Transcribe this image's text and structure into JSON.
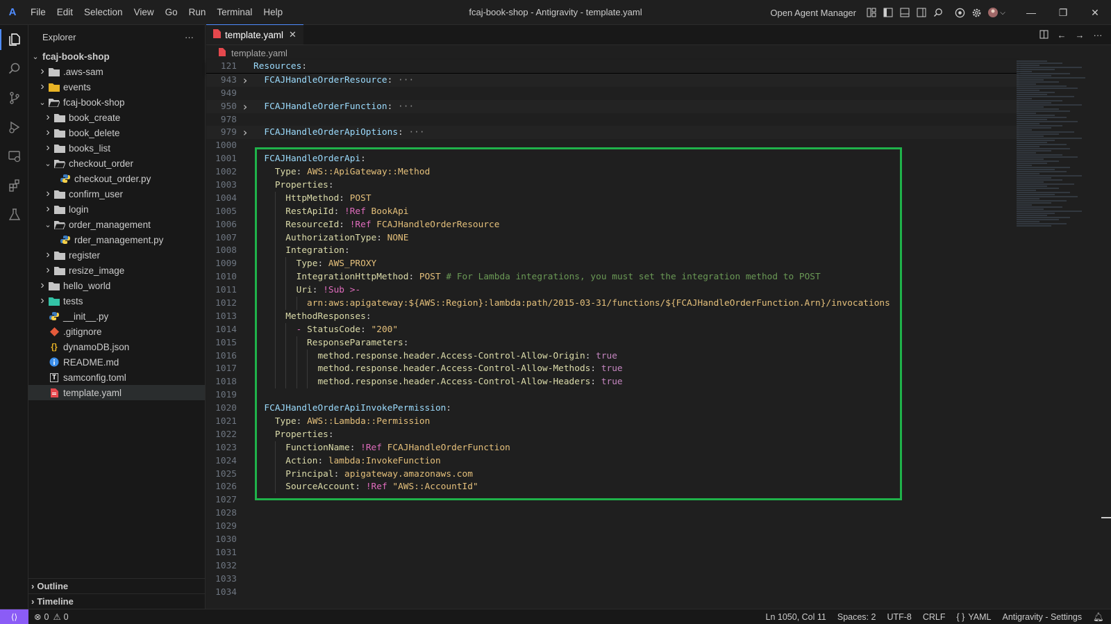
{
  "window": {
    "title": "fcaj-book-shop - Antigravity - template.yaml",
    "logo": "A",
    "open_agent_manager": "Open Agent Manager",
    "menu": [
      "File",
      "Edit",
      "Selection",
      "View",
      "Go",
      "Run",
      "Terminal",
      "Help"
    ]
  },
  "activity_bar": {
    "items": [
      "explorer-icon",
      "search-icon",
      "source-control-icon",
      "run-debug-icon",
      "remote-explorer-icon",
      "extensions-icon",
      "testing-icon"
    ]
  },
  "sidebar": {
    "title": "Explorer",
    "more": "···",
    "root": "fcaj-book-shop",
    "tree": [
      {
        "label": ".aws-sam",
        "depth": 1,
        "kind": "folder",
        "open": false
      },
      {
        "label": "events",
        "depth": 1,
        "kind": "folder-yellow",
        "open": false
      },
      {
        "label": "fcaj-book-shop",
        "depth": 1,
        "kind": "folder",
        "open": true
      },
      {
        "label": "book_create",
        "depth": 2,
        "kind": "folder",
        "open": false
      },
      {
        "label": "book_delete",
        "depth": 2,
        "kind": "folder",
        "open": false
      },
      {
        "label": "books_list",
        "depth": 2,
        "kind": "folder",
        "open": false
      },
      {
        "label": "checkout_order",
        "depth": 2,
        "kind": "folder",
        "open": true
      },
      {
        "label": "checkout_order.py",
        "depth": 3,
        "kind": "python"
      },
      {
        "label": "confirm_user",
        "depth": 2,
        "kind": "folder",
        "open": false
      },
      {
        "label": "login",
        "depth": 2,
        "kind": "folder",
        "open": false
      },
      {
        "label": "order_management",
        "depth": 2,
        "kind": "folder",
        "open": true
      },
      {
        "label": "rder_management.py",
        "depth": 3,
        "kind": "python"
      },
      {
        "label": "register",
        "depth": 2,
        "kind": "folder",
        "open": false
      },
      {
        "label": "resize_image",
        "depth": 2,
        "kind": "folder",
        "open": false
      },
      {
        "label": "hello_world",
        "depth": 1,
        "kind": "folder",
        "open": false
      },
      {
        "label": "tests",
        "depth": 1,
        "kind": "folder-tests",
        "open": false
      },
      {
        "label": "__init__.py",
        "depth": 1,
        "kind": "python"
      },
      {
        "label": ".gitignore",
        "depth": 1,
        "kind": "git"
      },
      {
        "label": "dynamoDB.json",
        "depth": 1,
        "kind": "json"
      },
      {
        "label": "README.md",
        "depth": 1,
        "kind": "info"
      },
      {
        "label": "samconfig.toml",
        "depth": 1,
        "kind": "toml"
      },
      {
        "label": "template.yaml",
        "depth": 1,
        "kind": "yaml",
        "selected": true
      }
    ],
    "sections": [
      "Outline",
      "Timeline"
    ]
  },
  "editor": {
    "tab": {
      "label": "template.yaml",
      "close": "✕"
    },
    "breadcrumb": "template.yaml",
    "lines": [
      {
        "n": "121",
        "sticky": true,
        "tokens": [
          [
            "k",
            "Resources"
          ],
          [
            "t",
            ":"
          ]
        ]
      },
      {
        "n": "943",
        "fold": true,
        "folded": true,
        "tokens": [
          [
            "t",
            "  "
          ],
          [
            "k",
            "FCAJHandleOrderResource"
          ],
          [
            "t",
            ": "
          ],
          [
            "e",
            "···"
          ]
        ]
      },
      {
        "n": "949",
        "tokens": []
      },
      {
        "n": "950",
        "fold": true,
        "folded": true,
        "tokens": [
          [
            "t",
            "  "
          ],
          [
            "k",
            "FCAJHandleOrderFunction"
          ],
          [
            "t",
            ": "
          ],
          [
            "e",
            "···"
          ]
        ]
      },
      {
        "n": "978",
        "tokens": []
      },
      {
        "n": "979",
        "fold": true,
        "folded": true,
        "tokens": [
          [
            "t",
            "  "
          ],
          [
            "k",
            "FCAJHandleOrderApiOptions"
          ],
          [
            "t",
            ": "
          ],
          [
            "e",
            "···"
          ]
        ]
      },
      {
        "n": "1000",
        "tokens": []
      },
      {
        "n": "1001",
        "tokens": [
          [
            "t",
            "  "
          ],
          [
            "k",
            "FCAJHandleOrderApi"
          ],
          [
            "t",
            ":"
          ]
        ]
      },
      {
        "n": "1002",
        "tokens": [
          [
            "t",
            "    "
          ],
          [
            "y",
            "Type"
          ],
          [
            "t",
            ": "
          ],
          [
            "s",
            "AWS::ApiGateway::Method"
          ]
        ]
      },
      {
        "n": "1003",
        "tokens": [
          [
            "t",
            "    "
          ],
          [
            "y",
            "Properties"
          ],
          [
            "t",
            ":"
          ]
        ]
      },
      {
        "n": "1004",
        "tokens": [
          [
            "t",
            "      "
          ],
          [
            "y",
            "HttpMethod"
          ],
          [
            "t",
            ": "
          ],
          [
            "s",
            "POST"
          ]
        ]
      },
      {
        "n": "1005",
        "tokens": [
          [
            "t",
            "      "
          ],
          [
            "y",
            "RestApiId"
          ],
          [
            "t",
            ": "
          ],
          [
            "g",
            "!Ref"
          ],
          [
            "t",
            " "
          ],
          [
            "s",
            "BookApi"
          ]
        ]
      },
      {
        "n": "1006",
        "tokens": [
          [
            "t",
            "      "
          ],
          [
            "y",
            "ResourceId"
          ],
          [
            "t",
            ": "
          ],
          [
            "g",
            "!Ref"
          ],
          [
            "t",
            " "
          ],
          [
            "s",
            "FCAJHandleOrderResource"
          ]
        ]
      },
      {
        "n": "1007",
        "tokens": [
          [
            "t",
            "      "
          ],
          [
            "y",
            "AuthorizationType"
          ],
          [
            "t",
            ": "
          ],
          [
            "s",
            "NONE"
          ]
        ]
      },
      {
        "n": "1008",
        "tokens": [
          [
            "t",
            "      "
          ],
          [
            "y",
            "Integration"
          ],
          [
            "t",
            ":"
          ]
        ]
      },
      {
        "n": "1009",
        "tokens": [
          [
            "t",
            "        "
          ],
          [
            "y",
            "Type"
          ],
          [
            "t",
            ": "
          ],
          [
            "s",
            "AWS_PROXY"
          ]
        ]
      },
      {
        "n": "1010",
        "tokens": [
          [
            "t",
            "        "
          ],
          [
            "y",
            "IntegrationHttpMethod"
          ],
          [
            "t",
            ": "
          ],
          [
            "s",
            "POST"
          ],
          [
            "t",
            " "
          ],
          [
            "c",
            "# For Lambda integrations, you must set the integration method to POST"
          ]
        ]
      },
      {
        "n": "1011",
        "tokens": [
          [
            "t",
            "        "
          ],
          [
            "y",
            "Uri"
          ],
          [
            "t",
            ": "
          ],
          [
            "g",
            "!Sub"
          ],
          [
            "t",
            " "
          ],
          [
            "g",
            ">-"
          ]
        ]
      },
      {
        "n": "1012",
        "tokens": [
          [
            "t",
            "          "
          ],
          [
            "s",
            "arn:aws:apigateway:${AWS::Region}:lambda:path/2015-03-31/functions/${FCAJHandleOrderFunction.Arn}/invocations"
          ]
        ]
      },
      {
        "n": "1013",
        "tokens": [
          [
            "t",
            "      "
          ],
          [
            "y",
            "MethodResponses"
          ],
          [
            "t",
            ":"
          ]
        ]
      },
      {
        "n": "1014",
        "tokens": [
          [
            "t",
            "        "
          ],
          [
            "g",
            "- "
          ],
          [
            "y",
            "StatusCode"
          ],
          [
            "t",
            ": "
          ],
          [
            "s",
            "\"200\""
          ]
        ]
      },
      {
        "n": "1015",
        "tokens": [
          [
            "t",
            "          "
          ],
          [
            "y",
            "ResponseParameters"
          ],
          [
            "t",
            ":"
          ]
        ]
      },
      {
        "n": "1016",
        "tokens": [
          [
            "t",
            "            "
          ],
          [
            "y",
            "method.response.header.Access-Control-Allow-Origin"
          ],
          [
            "t",
            ": "
          ],
          [
            "b",
            "true"
          ]
        ]
      },
      {
        "n": "1017",
        "tokens": [
          [
            "t",
            "            "
          ],
          [
            "y",
            "method.response.header.Access-Control-Allow-Methods"
          ],
          [
            "t",
            ": "
          ],
          [
            "b",
            "true"
          ]
        ]
      },
      {
        "n": "1018",
        "tokens": [
          [
            "t",
            "            "
          ],
          [
            "y",
            "method.response.header.Access-Control-Allow-Headers"
          ],
          [
            "t",
            ": "
          ],
          [
            "b",
            "true"
          ]
        ]
      },
      {
        "n": "1019",
        "tokens": []
      },
      {
        "n": "1020",
        "tokens": [
          [
            "t",
            "  "
          ],
          [
            "k",
            "FCAJHandleOrderApiInvokePermission"
          ],
          [
            "t",
            ":"
          ]
        ]
      },
      {
        "n": "1021",
        "tokens": [
          [
            "t",
            "    "
          ],
          [
            "y",
            "Type"
          ],
          [
            "t",
            ": "
          ],
          [
            "s",
            "AWS::Lambda::Permission"
          ]
        ]
      },
      {
        "n": "1022",
        "tokens": [
          [
            "t",
            "    "
          ],
          [
            "y",
            "Properties"
          ],
          [
            "t",
            ":"
          ]
        ]
      },
      {
        "n": "1023",
        "tokens": [
          [
            "t",
            "      "
          ],
          [
            "y",
            "FunctionName"
          ],
          [
            "t",
            ": "
          ],
          [
            "g",
            "!Ref"
          ],
          [
            "t",
            " "
          ],
          [
            "s",
            "FCAJHandleOrderFunction"
          ]
        ]
      },
      {
        "n": "1024",
        "tokens": [
          [
            "t",
            "      "
          ],
          [
            "y",
            "Action"
          ],
          [
            "t",
            ": "
          ],
          [
            "s",
            "lambda:InvokeFunction"
          ]
        ]
      },
      {
        "n": "1025",
        "tokens": [
          [
            "t",
            "      "
          ],
          [
            "y",
            "Principal"
          ],
          [
            "t",
            ": "
          ],
          [
            "s",
            "apigateway.amazonaws.com"
          ]
        ]
      },
      {
        "n": "1026",
        "tokens": [
          [
            "t",
            "      "
          ],
          [
            "y",
            "SourceAccount"
          ],
          [
            "t",
            ": "
          ],
          [
            "g",
            "!Ref"
          ],
          [
            "t",
            " "
          ],
          [
            "s",
            "\"AWS::AccountId\""
          ]
        ]
      },
      {
        "n": "1027",
        "tokens": []
      },
      {
        "n": "1028",
        "tokens": []
      },
      {
        "n": "1029",
        "tokens": []
      },
      {
        "n": "1030",
        "tokens": []
      },
      {
        "n": "1031",
        "tokens": []
      },
      {
        "n": "1032",
        "tokens": []
      },
      {
        "n": "1033",
        "tokens": []
      },
      {
        "n": "1034",
        "tokens": []
      }
    ]
  },
  "statusbar": {
    "errors": "0",
    "warnings": "0",
    "position": "Ln 1050, Col 11",
    "spaces": "Spaces: 2",
    "encoding": "UTF-8",
    "eol": "CRLF",
    "language": "YAML",
    "settings": "Antigravity - Settings"
  },
  "colors": {
    "highlight_box": "#1fb24a",
    "accent": "#4f8cff",
    "remote": "#8b5cf6"
  }
}
